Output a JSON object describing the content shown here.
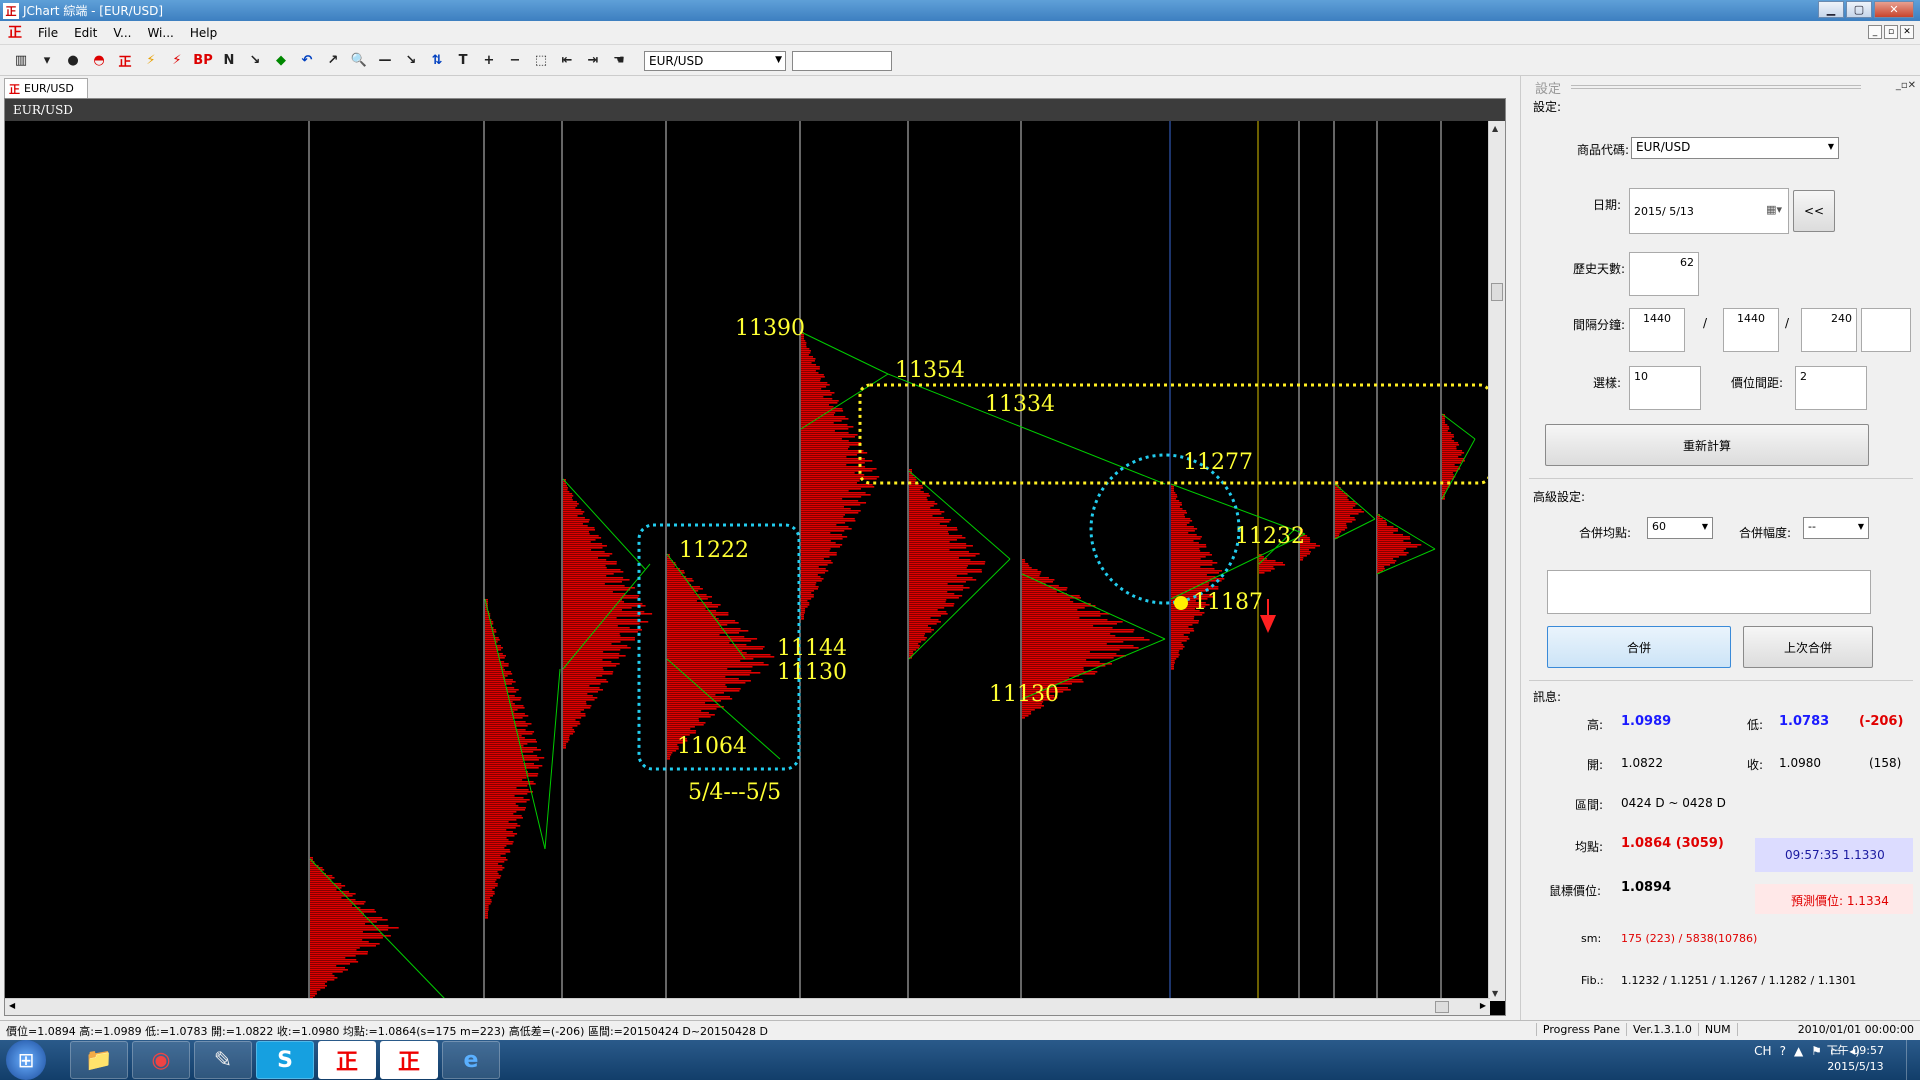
{
  "window": {
    "title": "JChart 綜端 - [EUR/USD]",
    "min": "▁",
    "max": "▢",
    "close": "✕"
  },
  "menu": [
    "File",
    "Edit",
    "V...",
    "Wi...",
    "Help"
  ],
  "mdi_controls": [
    "_",
    "▫",
    "✕"
  ],
  "toolbar": {
    "icons": [
      "bar-chart-icon",
      "dropdown-icon",
      "record-icon",
      "mushroom-icon",
      "logo-zheng-icon",
      "lightning-icon",
      "lightning-red-icon",
      "bp-icon",
      "n-icon",
      "cursor-icon",
      "eraser-icon",
      "undo-icon",
      "cursor-line-icon",
      "zoom-icon",
      "hline-icon",
      "trend-icon",
      "fib-icon",
      "text-icon",
      "plus-icon",
      "minus-icon",
      "select-icon",
      "back-icon",
      "forward-icon",
      "hand-icon"
    ],
    "glyphs": [
      "▥",
      "▾",
      "●",
      "◓",
      "正",
      "⚡",
      "⚡",
      "BP",
      "N",
      "↘",
      "◆",
      "↶",
      "↗",
      "🔍",
      "—",
      "↘",
      "⇅",
      "T",
      "+",
      "−",
      "⬚",
      "⇤",
      "⇥",
      "☚"
    ],
    "symbol": "EUR/USD"
  },
  "doc_tab": {
    "logo": "正",
    "label": "EUR/USD"
  },
  "chart": {
    "header": "EUR/USD",
    "annotations": [
      {
        "text": "11390"
      },
      {
        "text": "11354"
      },
      {
        "text": "11334"
      },
      {
        "text": "11277"
      },
      {
        "text": "11222"
      },
      {
        "text": "11232"
      },
      {
        "text": "11144"
      },
      {
        "text": "11130"
      },
      {
        "text": "11187"
      },
      {
        "text": "11130"
      },
      {
        "text": "11064"
      },
      {
        "text": "5/4---5/5"
      }
    ],
    "colors": {
      "profile": "#e00000",
      "trend": "#00cc00",
      "label": "#ffff33",
      "cyan": "#22ccee",
      "yellow_box": "#ffee22",
      "blue_line": "#3a6ad8",
      "yellow_line": "#d8c000",
      "white_line": "#cccccc"
    }
  },
  "panel": {
    "title": "設定",
    "controls": "_▫✕",
    "section_settings": "設定:",
    "symbol_label": "商品代碼:",
    "symbol_value": "EUR/USD",
    "date_label": "日期:",
    "date_value": "2015/  5/13",
    "date_btn": "<<",
    "history_label": "歷史天數:",
    "history_value": "62",
    "interval_label": "間隔分鐘:",
    "interval_1": "1440",
    "interval_2": "1440",
    "interval_3": "240",
    "interval_sep": "/",
    "select_label": "選樣:",
    "select_value": "10",
    "spacing_label": "價位間距:",
    "spacing_value": "2",
    "recalc_btn": "重新計算",
    "section_advanced": "高級設定:",
    "merge_avg_label": "合併均點:",
    "merge_avg_value": "60",
    "merge_range_label": "合併幅度:",
    "merge_range_value": "--",
    "merge_btn": "合併",
    "prev_merge_btn": "上次合併",
    "section_info": "訊息:",
    "high_label": "高:",
    "high_value": "1.0989",
    "low_label": "低:",
    "low_value": "1.0783",
    "low_diff": "(-206)",
    "open_label": "開:",
    "open_value": "1.0822",
    "close_label": "收:",
    "close_value": "1.0980",
    "close_diff": "(158)",
    "range_label": "區間:",
    "range_value": "0424 D ~ 0428 D",
    "avg_label": "均點:",
    "avg_value": "1.0864 (3059)",
    "time_value": "09:57:35  1.1330",
    "cursor_label": "鼠標價位:",
    "cursor_value": "1.0894",
    "predict_value": "預測價位: 1.1334",
    "sm_label": "sm:",
    "sm_value": "175 (223) / 5838(10786)",
    "fib_label": "Fib.:",
    "fib_value": "1.1232 / 1.1251 / 1.1267 / 1.1282 / 1.1301"
  },
  "status": {
    "left": "價位=1.0894  高:=1.0989  低:=1.0783  開:=1.0822  收:=1.0980  均點:=1.0864(s=175 m=223)  高低差=(-206)  區間:=20150424 D~20150428 D",
    "progress": "Progress Pane",
    "version": "Ver.1.3.1.0",
    "num": "NUM",
    "datetime": "2010/01/01 00:00:00"
  },
  "taskbar": {
    "apps": [
      "folder-icon",
      "chrome-icon",
      "notepad-icon",
      "skype-icon",
      "jchart-icon",
      "jchart-icon-2",
      "ie-icon"
    ],
    "glyphs": [
      "📁",
      "◉",
      "✎",
      "S",
      "正",
      "正",
      "e"
    ],
    "ime": "CH",
    "clock_line1": "下午 09:57",
    "clock_line2": "2015/5/13"
  }
}
